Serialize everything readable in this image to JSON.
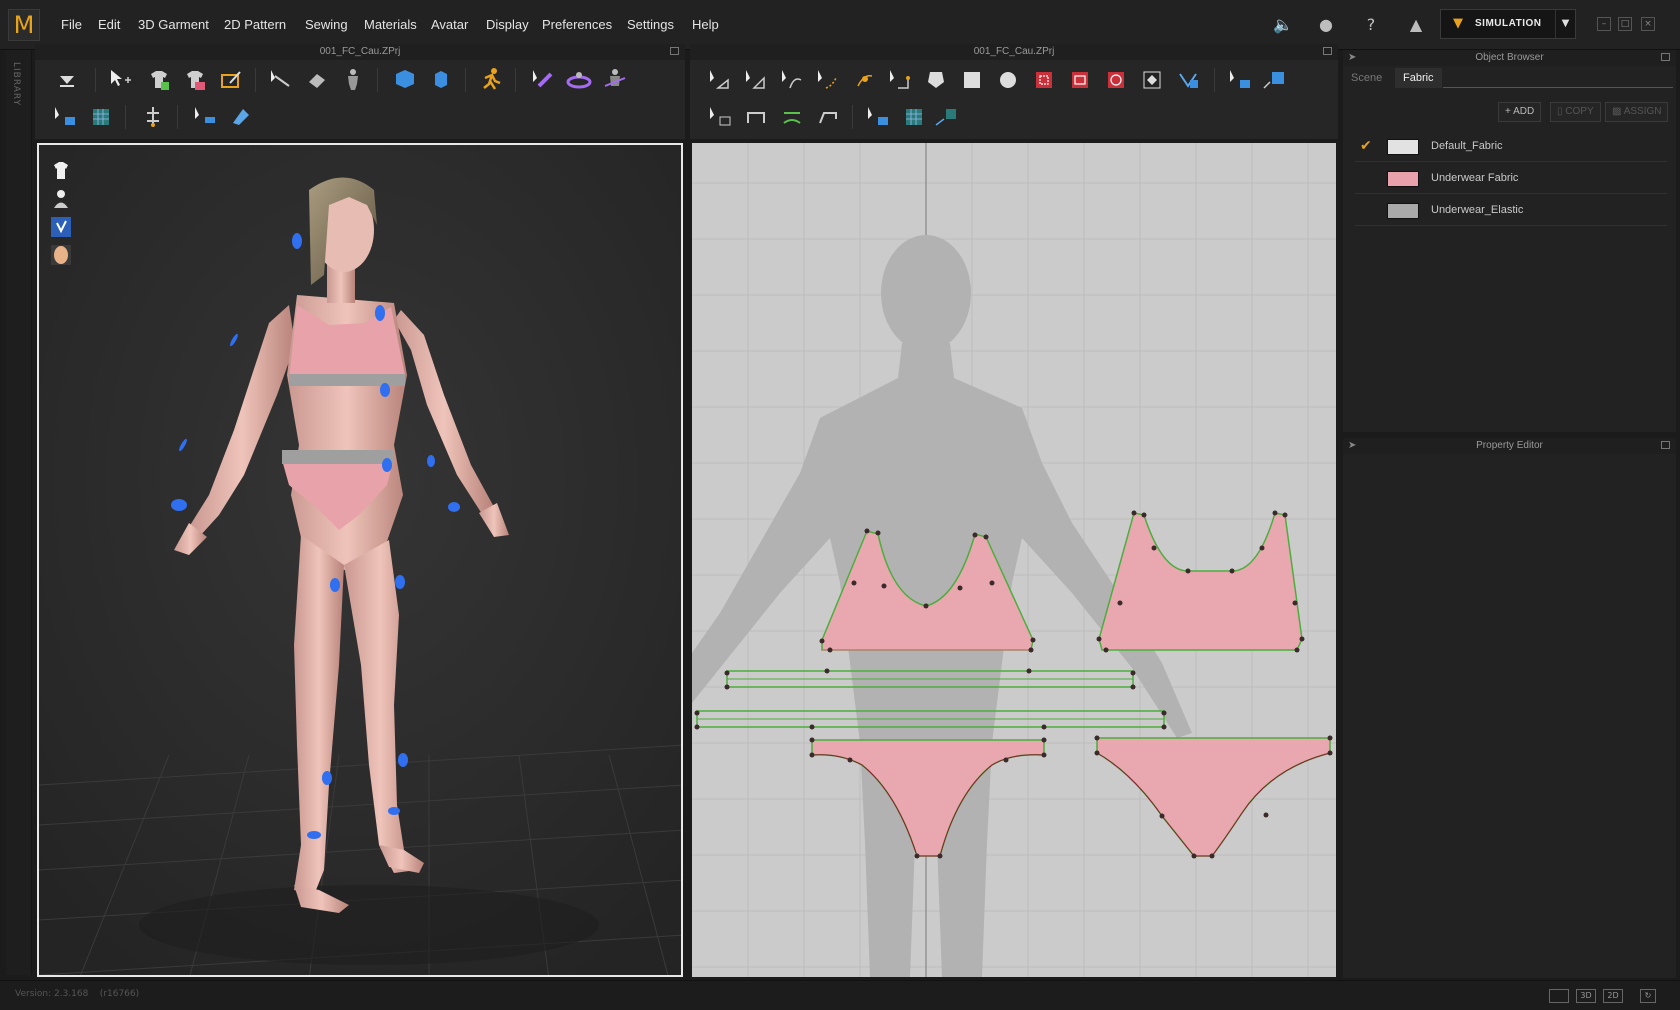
{
  "app": {
    "logo_letter": "M",
    "menu": [
      "File",
      "Edit",
      "3D Garment",
      "2D Pattern",
      "Sewing",
      "Materials",
      "Avatar",
      "Display",
      "Preferences",
      "Settings",
      "Help"
    ],
    "mode_label": "SIMULATION",
    "library_label": "LIBRARY"
  },
  "panels": {
    "viewport3d_title": "001_FC_Cau.ZPrj",
    "viewport2d_title": "001_FC_Cau.ZPrj",
    "object_browser_title": "Object Browser",
    "property_editor_title": "Property Editor"
  },
  "object_browser": {
    "tabs": [
      "Scene",
      "Fabric"
    ],
    "active_tab": "Fabric",
    "buttons": {
      "add": "ADD",
      "copy": "COPY",
      "assign": "ASSIGN"
    },
    "fabrics": [
      {
        "name": "Default_Fabric",
        "color": "#e2e2e2",
        "checked": true
      },
      {
        "name": "Underwear Fabric",
        "color": "#e9a1ab",
        "checked": false
      },
      {
        "name": "Underwear_Elastic",
        "color": "#a9a9a9",
        "checked": false
      }
    ]
  },
  "status": {
    "version": "Version: 2.3.168",
    "build": "(r16766)",
    "view_buttons": [
      "",
      "3D",
      "2D"
    ]
  },
  "colors": {
    "accent": "#e8a21b",
    "fabric_pink": "#e9a7b0",
    "seam_green": "#4cae3d",
    "pin_blue": "#2f6ff0"
  }
}
